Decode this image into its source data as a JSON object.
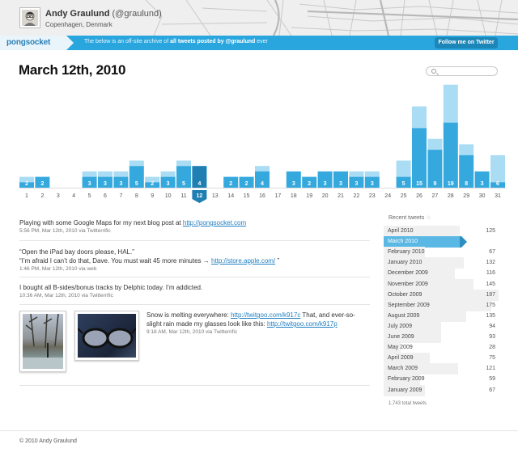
{
  "header": {
    "user_name": "Andy Graulund",
    "handle": "(@graulund)",
    "location": "Copenhagen, Denmark"
  },
  "bar": {
    "logo": "pongsocket",
    "text_prefix": "The below is an off-site archive of ",
    "text_bold": "all tweets posted by @graulund",
    "text_suffix": " ever",
    "follow_label": "Follow me on Twitter"
  },
  "page_title": "March 12th, 2010",
  "search": {
    "placeholder": ""
  },
  "chart_data": {
    "type": "bar",
    "selected_day": 12,
    "days": [
      1,
      2,
      3,
      4,
      5,
      6,
      7,
      8,
      9,
      10,
      11,
      12,
      13,
      14,
      15,
      16,
      17,
      18,
      19,
      20,
      21,
      22,
      23,
      24,
      25,
      26,
      27,
      28,
      29,
      30,
      31
    ],
    "labels": [
      "2",
      "2",
      "",
      "",
      "3",
      "3",
      "3",
      "5",
      "2",
      "3",
      "5",
      "4",
      "",
      "2",
      "2",
      "4",
      "",
      "3",
      "2",
      "3",
      "3",
      "3",
      "3",
      "",
      "5",
      "15",
      "9",
      "19",
      "8",
      "3",
      "6"
    ],
    "total": [
      2,
      2,
      0,
      0,
      3,
      3,
      3,
      5,
      2,
      3,
      5,
      4,
      0,
      2,
      2,
      4,
      0,
      3,
      2,
      3,
      3,
      3,
      3,
      0,
      5,
      15,
      9,
      19,
      8,
      3,
      6
    ],
    "extra": [
      1,
      0,
      0,
      0,
      1,
      1,
      1,
      1,
      1,
      1,
      1,
      0,
      0,
      0,
      0,
      1,
      0,
      0,
      0,
      0,
      0,
      1,
      1,
      0,
      3,
      4,
      2,
      7,
      2,
      0,
      5
    ]
  },
  "tweets": [
    {
      "text": "Playing with some Google Maps for my next blog post at ",
      "link": "http://pongsocket.com",
      "meta": "5:56 PM, Mar 12th, 2010 via Twitterrific"
    },
    {
      "text1": "“Open the iPad bay doors please, HAL.”",
      "text2": "“I’m afraid I can’t do that, Dave. You must wait 45 more minutes → ",
      "link": "http://store.apple.com/",
      "text2_end": " ”",
      "meta": "1:46 PM, Mar 12th, 2010 via web"
    },
    {
      "text": "I bought all B-sides/bonus tracks by Delphic today. I’m addicted.",
      "meta": "10:36 AM, Mar 12th, 2010 via Twitterrific"
    },
    {
      "text1": "Snow is melting everywhere: ",
      "link1": "http://twitgoo.com/k917c",
      "text2": " That, and ever-so-slight rain made my glasses look like this: ",
      "link2": "http://twitgoo.com/k917p",
      "meta": "9:18 AM, Mar 12th, 2010 via Twitterrific"
    }
  ],
  "sidebar": {
    "title": "Recent tweets",
    "months": [
      {
        "label": "April 2010",
        "count": "125",
        "fill": 0.66
      },
      {
        "label": "March 2010",
        "count": "124",
        "fill": 0.66,
        "selected": true
      },
      {
        "label": "February 2010",
        "count": "67",
        "fill": 0.36
      },
      {
        "label": "January 2010",
        "count": "132",
        "fill": 0.7
      },
      {
        "label": "December 2009",
        "count": "116",
        "fill": 0.62
      },
      {
        "label": "November 2009",
        "count": "145",
        "fill": 0.78
      },
      {
        "label": "October 2009",
        "count": "187",
        "fill": 1.0
      },
      {
        "label": "September 2009",
        "count": "175",
        "fill": 0.94
      },
      {
        "label": "August 2009",
        "count": "135",
        "fill": 0.72
      },
      {
        "label": "July 2009",
        "count": "94",
        "fill": 0.5
      },
      {
        "label": "June 2009",
        "count": "93",
        "fill": 0.5
      },
      {
        "label": "May 2009",
        "count": "28",
        "fill": 0.15
      },
      {
        "label": "April 2009",
        "count": "75",
        "fill": 0.4
      },
      {
        "label": "March 2009",
        "count": "121",
        "fill": 0.65
      },
      {
        "label": "February 2009",
        "count": "59",
        "fill": 0.32
      },
      {
        "label": "January 2009",
        "count": "67",
        "fill": 0.36
      }
    ],
    "total": "1,743 total tweets"
  },
  "footer": "© 2010 Andy Graulund",
  "colors": {
    "bar": "#35a9de",
    "bar_light": "#aadcf4",
    "selected": "#1f7fb3",
    "accent": "#2aa6de"
  }
}
